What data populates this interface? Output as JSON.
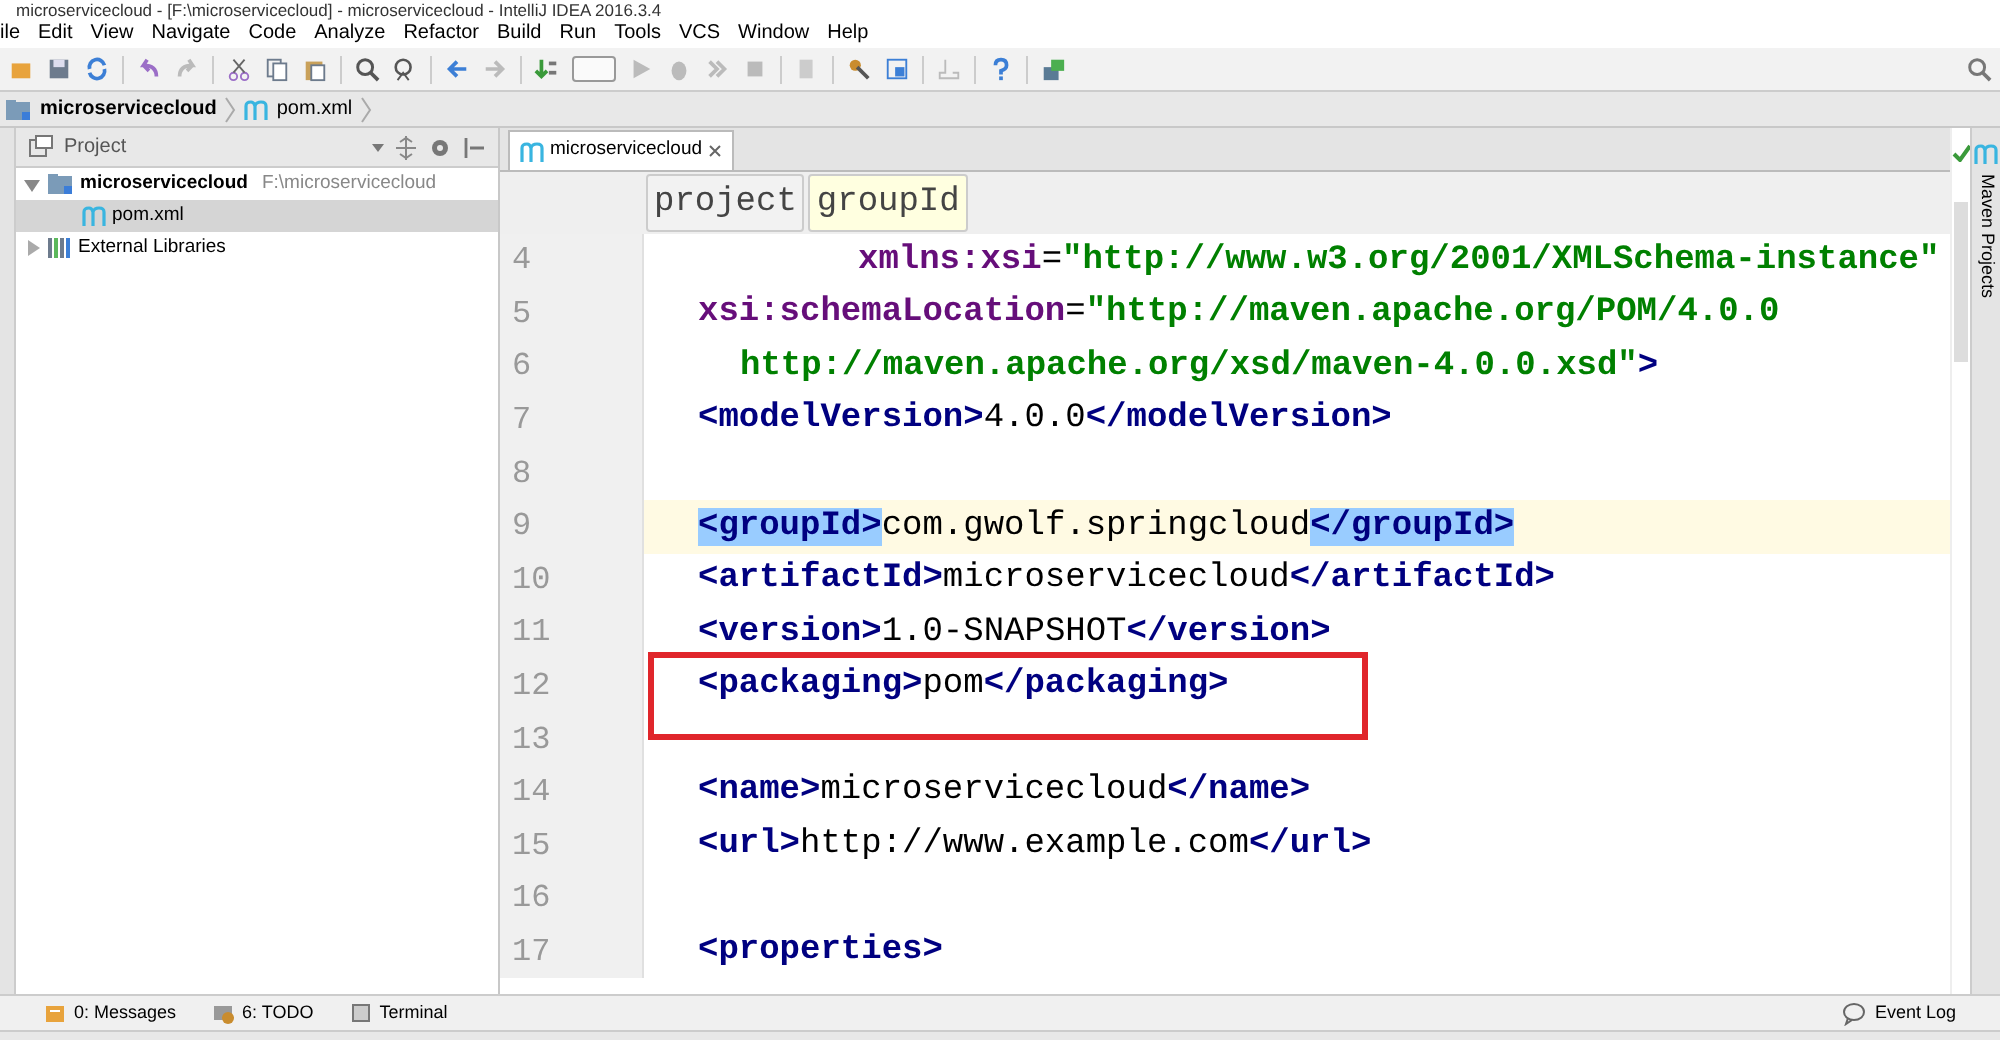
{
  "window": {
    "title": "microservicecloud - [F:\\microservicecloud] - microservicecloud - IntelliJ IDEA 2016.3.4"
  },
  "menu": [
    "ile",
    "Edit",
    "View",
    "Navigate",
    "Code",
    "Analyze",
    "Refactor",
    "Build",
    "Run",
    "Tools",
    "VCS",
    "Window",
    "Help"
  ],
  "breadcrumb": [
    "microservicecloud",
    "pom.xml"
  ],
  "project_panel": {
    "title": "Project",
    "tree": [
      {
        "label": "microservicecloud",
        "path": "F:\\microservicecloud",
        "kind": "module",
        "expanded": true,
        "selected": false,
        "children": [
          {
            "label": "pom.xml",
            "kind": "maven",
            "selected": true
          }
        ]
      },
      {
        "label": "External Libraries",
        "kind": "library",
        "expanded": false,
        "selected": false
      }
    ]
  },
  "editor": {
    "tabs": [
      {
        "label": "microservicecloud",
        "selected": true
      }
    ],
    "tag_path": [
      {
        "label": "project",
        "selected": false
      },
      {
        "label": "groupId",
        "selected": true
      }
    ],
    "lines": [
      {
        "number": "4",
        "kind": "namespace",
        "tokens": [
          {
            "kind": "attr",
            "text": "xmlns:xsi"
          },
          {
            "kind": "text",
            "text": "="
          },
          {
            "kind": "value",
            "text": "\"http://www.w3.org/2001/XMLSchema-instance\""
          }
        ]
      },
      {
        "number": "5",
        "kind": "element",
        "tokens": [
          {
            "kind": "attr",
            "text": "xsi:schemaLocation"
          },
          {
            "kind": "text",
            "text": "="
          },
          {
            "kind": "value",
            "text": "\"http://maven.apache.org/POM/4.0.0"
          }
        ]
      },
      {
        "number": "6",
        "kind": "continuation",
        "tokens": [
          {
            "kind": "value",
            "text": "http://maven.apache.org/xsd/maven-4.0.0.xsd\""
          },
          {
            "kind": "tag",
            "text": ">"
          }
        ]
      },
      {
        "number": "7",
        "kind": "element",
        "tokens": [
          {
            "kind": "tag",
            "text": "<modelVersion>"
          },
          {
            "kind": "text",
            "text": "4.0.0"
          },
          {
            "kind": "tag",
            "text": "</modelVersion>"
          }
        ]
      },
      {
        "number": "8",
        "kind": "blank"
      },
      {
        "number": "9",
        "kind": "element",
        "current": true,
        "tokens": [
          {
            "kind": "match",
            "text": "<groupId>"
          },
          {
            "kind": "text",
            "text": "com.gwolf.springcloud"
          },
          {
            "kind": "match",
            "text": "</groupId>"
          }
        ]
      },
      {
        "number": "10",
        "kind": "element",
        "tokens": [
          {
            "kind": "tag",
            "text": "<artifactId>"
          },
          {
            "kind": "text",
            "text": "microservicecloud"
          },
          {
            "kind": "tag",
            "text": "</artifactId>"
          }
        ]
      },
      {
        "number": "11",
        "kind": "element",
        "tokens": [
          {
            "kind": "tag",
            "text": "<version>"
          },
          {
            "kind": "text",
            "text": "1.0-SNAPSHOT"
          },
          {
            "kind": "tag",
            "text": "</version>"
          }
        ]
      },
      {
        "number": "12",
        "kind": "element",
        "boxed": true,
        "tokens": [
          {
            "kind": "tag",
            "text": "<packaging>"
          },
          {
            "kind": "text",
            "text": "pom"
          },
          {
            "kind": "tag",
            "text": "</packaging>"
          }
        ]
      },
      {
        "number": "13",
        "kind": "blank"
      },
      {
        "number": "14",
        "kind": "element",
        "tokens": [
          {
            "kind": "tag",
            "text": "<name>"
          },
          {
            "kind": "text",
            "text": "microservicecloud"
          },
          {
            "kind": "tag",
            "text": "</name>"
          }
        ]
      },
      {
        "number": "15",
        "kind": "element",
        "tokens": [
          {
            "kind": "tag",
            "text": "<url>"
          },
          {
            "kind": "text",
            "text": "http://www.example.com"
          },
          {
            "kind": "tag",
            "text": "</url>"
          }
        ]
      },
      {
        "number": "16",
        "kind": "blank"
      },
      {
        "number": "17",
        "kind": "element",
        "tokens": [
          {
            "kind": "tag",
            "text": "<properties>"
          }
        ]
      }
    ]
  },
  "right_strip": {
    "label": "Maven Projects"
  },
  "bottom_tools": [
    {
      "label": "0: Messages",
      "kind": "messages"
    },
    {
      "label": "6: TODO",
      "kind": "todo"
    },
    {
      "label": "Terminal",
      "kind": "terminal"
    }
  ],
  "event_log": {
    "label": "Event Log"
  }
}
